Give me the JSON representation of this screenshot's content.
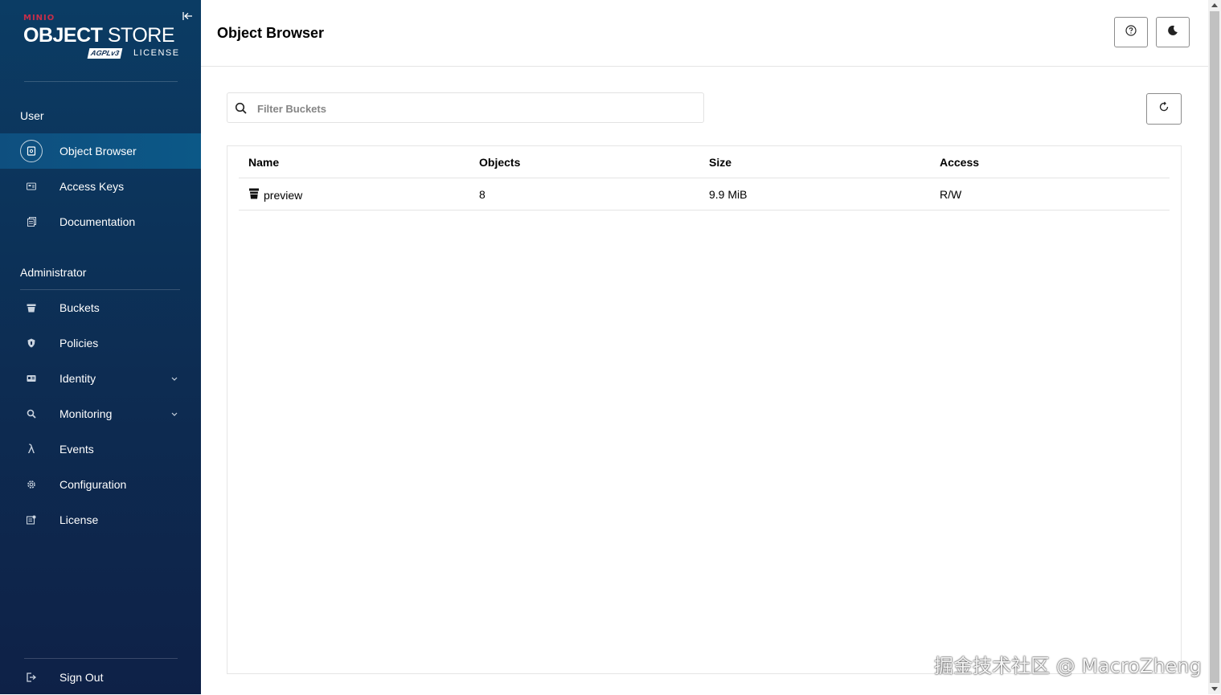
{
  "sidebar": {
    "logo": {
      "brand": "MINIO",
      "product_bold": "OBJECT",
      "product_light": "STORE",
      "badge": "AGPLv3",
      "license": "LICENSE"
    },
    "user_section_title": "User",
    "user_items": [
      {
        "label": "Object Browser",
        "icon": "object-browser-icon"
      },
      {
        "label": "Access Keys",
        "icon": "key-icon"
      },
      {
        "label": "Documentation",
        "icon": "document-icon"
      }
    ],
    "admin_section_title": "Administrator",
    "admin_items": [
      {
        "label": "Buckets",
        "icon": "bucket-icon"
      },
      {
        "label": "Policies",
        "icon": "shield-icon"
      },
      {
        "label": "Identity",
        "icon": "id-card-icon"
      },
      {
        "label": "Monitoring",
        "icon": "magnifier-icon"
      },
      {
        "label": "Events",
        "icon": "lambda-icon"
      },
      {
        "label": "Configuration",
        "icon": "gear-icon"
      },
      {
        "label": "License",
        "icon": "license-icon"
      }
    ],
    "sign_out": "Sign Out"
  },
  "header": {
    "title": "Object Browser"
  },
  "search": {
    "placeholder": "Filter Buckets",
    "value": ""
  },
  "table": {
    "columns": [
      "Name",
      "Objects",
      "Size",
      "Access"
    ],
    "rows": [
      {
        "name": "preview",
        "objects": "8",
        "size": "9.9 MiB",
        "access": "R/W"
      }
    ]
  },
  "watermark": "掘金技术社区 @ MacroZheng",
  "colors": {
    "sidebar_top": "#0b3c64",
    "sidebar_bottom": "#0e2147",
    "active_item": "#0c5887",
    "brand_red": "#c72e49"
  }
}
